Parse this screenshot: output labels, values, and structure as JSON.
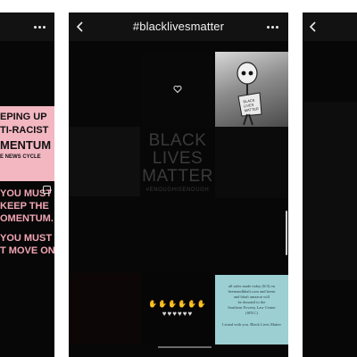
{
  "screens": {
    "left": {
      "poster_lines": [
        "EPING UP",
        "TI-RACIST",
        "MENTUM",
        "E NEWS CYCLE"
      ],
      "message_lines": [
        "YOU MUST",
        "KEEP THE",
        "OMENTUM.",
        "",
        "YOU MUST",
        "T MOVE ON."
      ]
    },
    "center": {
      "header": {
        "title": "#blacklivesmatter",
        "back_icon": "chevron-left-icon",
        "more_icon": "more-horizontal-icon"
      },
      "grid": {
        "heart_icon": "heart-outline-icon",
        "blm_lines": [
          "BLACK",
          "LIVES",
          "MATTER"
        ],
        "blm_tag": "#ENOUGHISENOUGH",
        "art_sign": "BLACK LIVES MATTER",
        "hands_rows": [
          "✋✋✋✋✋✋",
          "♥♥♥♥♥♥"
        ],
        "note_lines": [
          "all sales made today (6/3) on",
          "beemandbhaft.com and beem",
          "and bhaft amazon will",
          "be donated to the",
          "Southern Poverty Law Center",
          "(SPLC)",
          "",
          "I stand with you. Black Lives Matter"
        ]
      }
    },
    "right": {
      "back_icon": "chevron-left-icon"
    }
  },
  "colors": {
    "page": "#ffffff",
    "screen_bg": "#070707",
    "header_bg": "#121212",
    "poster_pink": "#f3b7c2",
    "message_pink": "#f1a6b4",
    "note_teal": "#9ccfd1"
  }
}
